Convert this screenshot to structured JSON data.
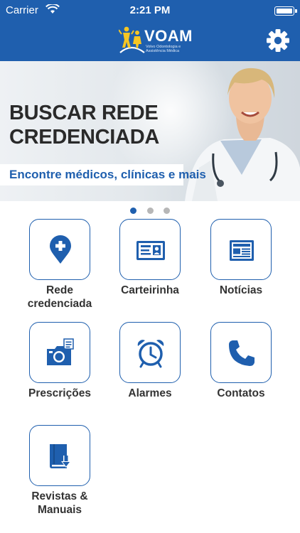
{
  "status_bar": {
    "carrier": "Carrier",
    "time": "2:21 PM"
  },
  "header": {
    "brand": "VOAM",
    "brand_subtitle": "Volvo Odontologia e Assistência Médica",
    "background_color": "#1f5fae"
  },
  "banner": {
    "title_line1": "BUSCAR REDE",
    "title_line2": "CREDENCIADA",
    "tagline": "Encontre médicos, clínicas e mais",
    "pager": {
      "total": 3,
      "active": 1
    }
  },
  "menu": [
    {
      "label_line1": "Rede",
      "label_line2": "credenciada",
      "icon": "location-pin-plus-icon"
    },
    {
      "label_line1": "Carteirinha",
      "label_line2": "",
      "icon": "id-card-icon"
    },
    {
      "label_line1": "Notícias",
      "label_line2": "",
      "icon": "newspaper-icon"
    },
    {
      "label_line1": "Prescrições",
      "label_line2": "",
      "icon": "camera-document-icon"
    },
    {
      "label_line1": "Alarmes",
      "label_line2": "",
      "icon": "alarm-clock-icon"
    },
    {
      "label_line1": "Contatos",
      "label_line2": "",
      "icon": "phone-icon"
    },
    {
      "label_line1": "Revistas &",
      "label_line2": "Manuais",
      "icon": "book-download-icon"
    }
  ],
  "colors": {
    "accent": "#1f5fae",
    "tile_border": "#1f5fae",
    "label_text": "#333333"
  }
}
